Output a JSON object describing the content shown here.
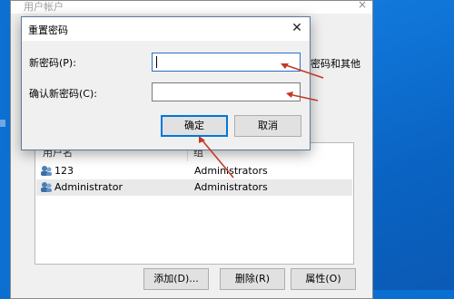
{
  "parent_window": {
    "title": "用户帐户",
    "close_glyph": "×",
    "partial_text": "密码和其他",
    "list": {
      "col_user": "用户名",
      "col_group": "组",
      "rows": [
        {
          "user": "123",
          "group": "Administrators"
        },
        {
          "user": "Administrator",
          "group": "Administrators"
        }
      ]
    },
    "buttons": {
      "add": "添加(D)...",
      "remove": "删除(R)",
      "properties": "属性(O)"
    }
  },
  "dialog": {
    "title": "重置密码",
    "close_glyph": "✕",
    "new_password_label": "新密码(P):",
    "new_password_value": "",
    "confirm_password_label": "确认新密码(C):",
    "confirm_password_value": "",
    "ok_label": "确定",
    "cancel_label": "取消"
  },
  "colors": {
    "annotation_arrow": "#c0392b",
    "focus_blue": "#0078d7",
    "desktop_blue": "#0f74d6"
  },
  "icons": {
    "user": "user-account-icon",
    "close": "close-icon"
  }
}
